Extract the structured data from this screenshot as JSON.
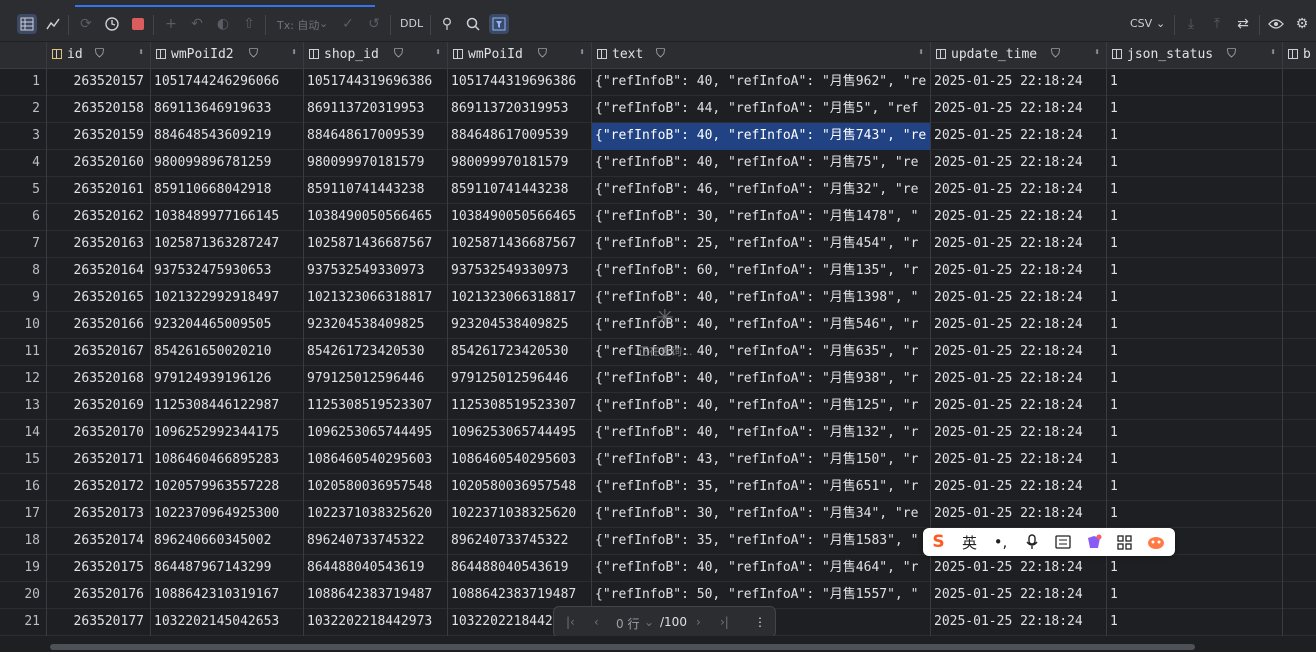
{
  "toolbar": {
    "tx_label": "Tx: 自动",
    "ddl_label": "DDL",
    "export_format": "CSV"
  },
  "columns": [
    {
      "name": "id",
      "key_icon": true
    },
    {
      "name": "wmPoiId2"
    },
    {
      "name": "shop_id"
    },
    {
      "name": "wmPoiId"
    },
    {
      "name": "text"
    },
    {
      "name": "update_time"
    },
    {
      "name": "json_status"
    },
    {
      "name": "b"
    }
  ],
  "rows": [
    {
      "n": "1",
      "id": "263520157",
      "wmPoiId2": "1051744246296066",
      "shop_id": "1051744319696386",
      "wmPoiId": "1051744319696386",
      "text": "{\"refInfoB\": 40, \"refInfoA\": \"月售962\", \"re",
      "update_time": "2025-01-25 22:18:24",
      "json_status": "1"
    },
    {
      "n": "2",
      "id": "263520158",
      "wmPoiId2": "869113646919633",
      "shop_id": "869113720319953",
      "wmPoiId": "869113720319953",
      "text": "{\"refInfoB\": 44, \"refInfoA\": \"月售5\", \"ref",
      "update_time": "2025-01-25 22:18:24",
      "json_status": "1"
    },
    {
      "n": "3",
      "id": "263520159",
      "wmPoiId2": "884648543609219",
      "shop_id": "884648617009539",
      "wmPoiId": "884648617009539",
      "text": "{\"refInfoB\": 40, \"refInfoA\": \"月售743\", \"re",
      "update_time": "2025-01-25 22:18:24",
      "json_status": "1",
      "selected": true
    },
    {
      "n": "4",
      "id": "263520160",
      "wmPoiId2": "980099896781259",
      "shop_id": "980099970181579",
      "wmPoiId": "980099970181579",
      "text": "{\"refInfoB\": 40, \"refInfoA\": \"月售75\", \"re",
      "update_time": "2025-01-25 22:18:24",
      "json_status": "1"
    },
    {
      "n": "5",
      "id": "263520161",
      "wmPoiId2": "859110668042918",
      "shop_id": "859110741443238",
      "wmPoiId": "859110741443238",
      "text": "{\"refInfoB\": 46, \"refInfoA\": \"月售32\", \"re",
      "update_time": "2025-01-25 22:18:24",
      "json_status": "1"
    },
    {
      "n": "6",
      "id": "263520162",
      "wmPoiId2": "1038489977166145",
      "shop_id": "1038490050566465",
      "wmPoiId": "1038490050566465",
      "text": "{\"refInfoB\": 30, \"refInfoA\": \"月售1478\", \"",
      "update_time": "2025-01-25 22:18:24",
      "json_status": "1"
    },
    {
      "n": "7",
      "id": "263520163",
      "wmPoiId2": "1025871363287247",
      "shop_id": "1025871436687567",
      "wmPoiId": "1025871436687567",
      "text": "{\"refInfoB\": 25, \"refInfoA\": \"月售454\", \"r",
      "update_time": "2025-01-25 22:18:24",
      "json_status": "1"
    },
    {
      "n": "8",
      "id": "263520164",
      "wmPoiId2": "937532475930653",
      "shop_id": "937532549330973",
      "wmPoiId": "937532549330973",
      "text": "{\"refInfoB\": 60, \"refInfoA\": \"月售135\", \"r",
      "update_time": "2025-01-25 22:18:24",
      "json_status": "1"
    },
    {
      "n": "9",
      "id": "263520165",
      "wmPoiId2": "1021322992918497",
      "shop_id": "1021323066318817",
      "wmPoiId": "1021323066318817",
      "text": "{\"refInfoB\": 40, \"refInfoA\": \"月售1398\", \"",
      "update_time": "2025-01-25 22:18:24",
      "json_status": "1"
    },
    {
      "n": "10",
      "id": "263520166",
      "wmPoiId2": "923204465009505",
      "shop_id": "923204538409825",
      "wmPoiId": "923204538409825",
      "text": "{\"refInfoB\": 40, \"refInfoA\": \"月售546\", \"r",
      "update_time": "2025-01-25 22:18:24",
      "json_status": "1"
    },
    {
      "n": "11",
      "id": "263520167",
      "wmPoiId2": "854261650020210",
      "shop_id": "854261723420530",
      "wmPoiId": "854261723420530",
      "text": "{\"refInfoB\": 40, \"refInfoA\": \"月售635\", \"r",
      "update_time": "2025-01-25 22:18:24",
      "json_status": "1"
    },
    {
      "n": "12",
      "id": "263520168",
      "wmPoiId2": "979124939196126",
      "shop_id": "979125012596446",
      "wmPoiId": "979125012596446",
      "text": "{\"refInfoB\": 40, \"refInfoA\": \"月售938\", \"r",
      "update_time": "2025-01-25 22:18:24",
      "json_status": "1"
    },
    {
      "n": "13",
      "id": "263520169",
      "wmPoiId2": "1125308446122987",
      "shop_id": "1125308519523307",
      "wmPoiId": "1125308519523307",
      "text": "{\"refInfoB\": 40, \"refInfoA\": \"月售125\", \"r",
      "update_time": "2025-01-25 22:18:24",
      "json_status": "1"
    },
    {
      "n": "14",
      "id": "263520170",
      "wmPoiId2": "1096252992344175",
      "shop_id": "1096253065744495",
      "wmPoiId": "1096253065744495",
      "text": "{\"refInfoB\": 40, \"refInfoA\": \"月售132\", \"r",
      "update_time": "2025-01-25 22:18:24",
      "json_status": "1"
    },
    {
      "n": "15",
      "id": "263520171",
      "wmPoiId2": "1086460466895283",
      "shop_id": "1086460540295603",
      "wmPoiId": "1086460540295603",
      "text": "{\"refInfoB\": 43, \"refInfoA\": \"月售150\", \"r",
      "update_time": "2025-01-25 22:18:24",
      "json_status": "1"
    },
    {
      "n": "16",
      "id": "263520172",
      "wmPoiId2": "1020579963557228",
      "shop_id": "1020580036957548",
      "wmPoiId": "1020580036957548",
      "text": "{\"refInfoB\": 35, \"refInfoA\": \"月售651\", \"r",
      "update_time": "2025-01-25 22:18:24",
      "json_status": "1"
    },
    {
      "n": "17",
      "id": "263520173",
      "wmPoiId2": "1022370964925300",
      "shop_id": "1022371038325620",
      "wmPoiId": "1022371038325620",
      "text": "{\"refInfoB\": 30, \"refInfoA\": \"月售34\", \"re",
      "update_time": "2025-01-25 22:18:24",
      "json_status": "1"
    },
    {
      "n": "18",
      "id": "263520174",
      "wmPoiId2": "896240660345002",
      "shop_id": "896240733745322",
      "wmPoiId": "896240733745322",
      "text": "{\"refInfoB\": 35, \"refInfoA\": \"月售1583\", \"",
      "update_time": "2025-01-25 22:18:24",
      "json_status": "1"
    },
    {
      "n": "19",
      "id": "263520175",
      "wmPoiId2": "864487967143299",
      "shop_id": "864488040543619",
      "wmPoiId": "864488040543619",
      "text": "{\"refInfoB\": 40, \"refInfoA\": \"月售464\", \"r",
      "update_time": "2025-01-25 22:18:24",
      "json_status": "1"
    },
    {
      "n": "20",
      "id": "263520176",
      "wmPoiId2": "1088642310319167",
      "shop_id": "1088642383719487",
      "wmPoiId": "1088642383719487",
      "text": "{\"refInfoB\": 50, \"refInfoA\": \"月售1557\", \"",
      "update_time": "2025-01-25 22:18:24",
      "json_status": "1"
    },
    {
      "n": "21",
      "id": "263520177",
      "wmPoiId2": "1032202145042653",
      "shop_id": "1032202218442973",
      "wmPoiId": "1032202218442",
      "text": "fA\": \"月售21\", \"re",
      "update_time": "2025-01-25 22:18:24",
      "json_status": "1"
    }
  ],
  "loading_text": "正在查询...",
  "pager": {
    "current": "0 行",
    "total": "/100"
  },
  "ime": {
    "logo": "S",
    "lang": "英"
  }
}
